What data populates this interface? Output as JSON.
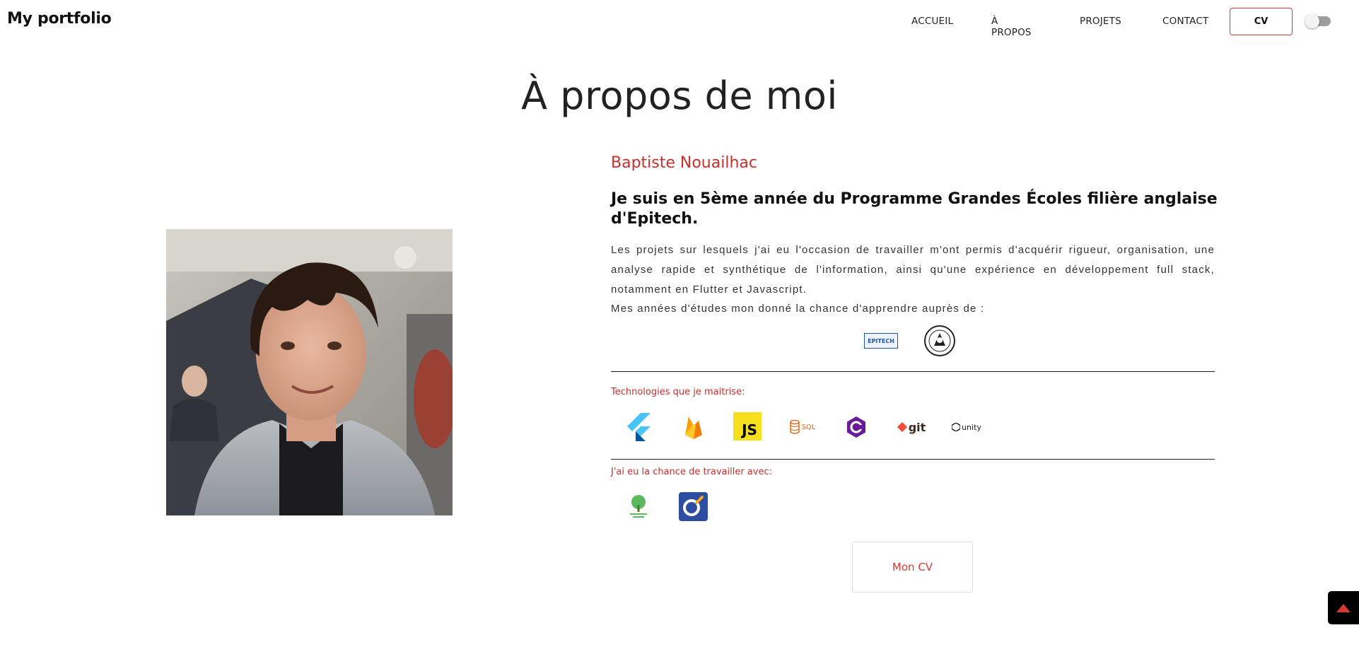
{
  "navbar": {
    "brand": "My portfolio",
    "links": [
      "ACCUEIL",
      "À PROPOS",
      "PROJETS",
      "CONTACT"
    ],
    "cv_button": "CV",
    "theme_toggle": "off"
  },
  "about": {
    "title": "À propos de moi",
    "name": "Baptiste Nouailhac",
    "headline": "Je suis en 5ème année du Programme Grandes Écoles filière anglaise d'Epitech.",
    "description": "Les projets sur lesquels j'ai eu l'occasion de travailler m'ont permis d'acquérir rigueur, organisation, une analyse rapide et synthétique de l'information, ainsi qu'une expérience en développement full stack, notamment en Flutter et Javascript.",
    "schools_intro": "Mes années d'études mon donné la chance d'apprendre auprès de :",
    "schools": [
      {
        "icon": "epitech-logo",
        "text": "EPITECH"
      },
      {
        "icon": "university-seal-logo"
      }
    ],
    "tech_label": "Technologies que je maitrise:",
    "technologies": [
      {
        "icon": "flutter-icon"
      },
      {
        "icon": "firebase-icon"
      },
      {
        "icon": "javascript-icon",
        "text": "JS"
      },
      {
        "icon": "sql-icon",
        "text": "SQL"
      },
      {
        "icon": "csharp-icon"
      },
      {
        "icon": "git-icon",
        "text": "git"
      },
      {
        "icon": "unity-icon",
        "text": "unity"
      }
    ],
    "work_label": "J'ai eu la chance de travailler avec:",
    "companies": [
      {
        "icon": "tree-company-logo"
      },
      {
        "icon": "orange-ring-company-logo"
      }
    ],
    "cv_link": "Mon CV"
  },
  "colors": {
    "accent": "#c9302c",
    "text": "#111111",
    "background": "#ffffff"
  }
}
